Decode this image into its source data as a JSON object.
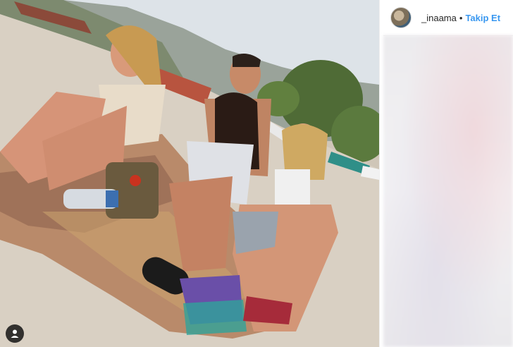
{
  "post": {
    "username": "_inaama",
    "separator": "•",
    "follow_label": "Takip Et"
  },
  "icons": {
    "user_tag": "user-icon",
    "avatar": "profile-avatar"
  },
  "colors": {
    "follow_link": "#3897f0",
    "sand": "#d8cfc0",
    "sky": "#dfe4e8"
  }
}
